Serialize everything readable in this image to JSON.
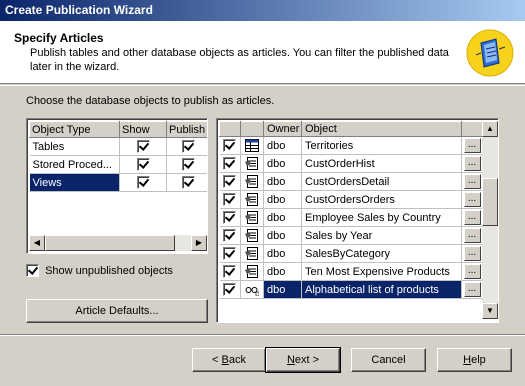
{
  "window": {
    "title": "Create Publication Wizard"
  },
  "header": {
    "title": "Specify Articles",
    "description": "Publish tables and other database objects as articles. You can filter the published data later in the wizard."
  },
  "instruction": "Choose the database objects to publish as articles.",
  "object_types": {
    "columns": [
      "Object Type",
      "Show",
      "Publish A"
    ],
    "rows": [
      {
        "type": "Tables",
        "show": true,
        "publish": true,
        "selected": false
      },
      {
        "type": "Stored Proced...",
        "show": true,
        "publish": true,
        "selected": false
      },
      {
        "type": "Views",
        "show": true,
        "publish": true,
        "selected": true
      }
    ]
  },
  "show_unpublished": {
    "label": "Show unpublished objects",
    "checked": true
  },
  "article_defaults_label": "Article Defaults...",
  "articles": {
    "columns": [
      "",
      "",
      "Owner",
      "Object",
      ""
    ],
    "ellipsis": "...",
    "rows": [
      {
        "checked": true,
        "icon": "table-icon",
        "owner": "dbo",
        "object": "Territories",
        "selected": false
      },
      {
        "checked": true,
        "icon": "stored-procedure-icon",
        "owner": "dbo",
        "object": "CustOrderHist",
        "selected": false
      },
      {
        "checked": true,
        "icon": "stored-procedure-icon",
        "owner": "dbo",
        "object": "CustOrdersDetail",
        "selected": false
      },
      {
        "checked": true,
        "icon": "stored-procedure-icon",
        "owner": "dbo",
        "object": "CustOrdersOrders",
        "selected": false
      },
      {
        "checked": true,
        "icon": "stored-procedure-icon",
        "owner": "dbo",
        "object": "Employee Sales by Country",
        "selected": false
      },
      {
        "checked": true,
        "icon": "stored-procedure-icon",
        "owner": "dbo",
        "object": "Sales by Year",
        "selected": false
      },
      {
        "checked": true,
        "icon": "stored-procedure-icon",
        "owner": "dbo",
        "object": "SalesByCategory",
        "selected": false
      },
      {
        "checked": true,
        "icon": "stored-procedure-icon",
        "owner": "dbo",
        "object": "Ten Most Expensive Products",
        "selected": false
      },
      {
        "checked": true,
        "icon": "view-icon",
        "owner": "dbo",
        "object": "Alphabetical list of products",
        "selected": true
      }
    ]
  },
  "buttons": {
    "back": {
      "prefix": "< ",
      "hotkey": "B",
      "rest": "ack"
    },
    "next": {
      "hotkey": "N",
      "rest": "ext >"
    },
    "cancel": "Cancel",
    "help": {
      "hotkey": "H",
      "rest": "elp"
    }
  },
  "colors": {
    "selection": "#0a246a",
    "titlebar_start": "#0a246a",
    "titlebar_end": "#a6caf0",
    "face": "#d4d0c8"
  }
}
